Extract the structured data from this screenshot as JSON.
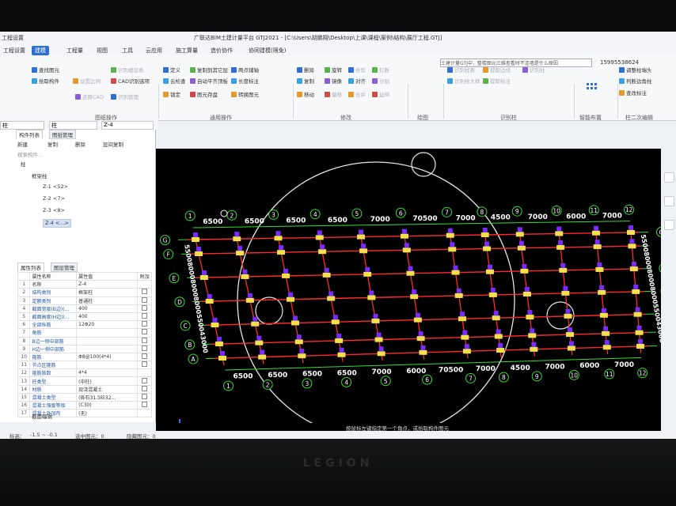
{
  "app": {
    "title": "广联达BIM土建计量平台 GTJ2021 - [C:\\Users\\胡鹏翔\\Desktop\\上课\\课程\\案例\\结构\\展厅工程.GTJ]",
    "quick_access": "工程设置"
  },
  "menu_tabs": [
    {
      "label": "工程设置",
      "active": false
    },
    {
      "label": "建模",
      "active": true
    },
    {
      "label": "工程量",
      "active": false
    },
    {
      "label": "视图",
      "active": false
    },
    {
      "label": "工具",
      "active": false
    },
    {
      "label": "云应用",
      "active": false
    },
    {
      "label": "施工算量",
      "active": false
    },
    {
      "label": "造价协作",
      "active": false
    },
    {
      "label": "协同建模(限免)",
      "active": false
    }
  ],
  "search": {
    "value": "土建计量GTJ中，整楼图元三维查看时不连墙是什么原因"
  },
  "phone": "15995538624",
  "ribbon": {
    "col1": [
      "查找图元",
      "拾取构件",
      "设置比例",
      "识别楼层表",
      "还原CAD",
      "CAD识别选项",
      "识别管理"
    ],
    "group_general": "通用操作",
    "general_items": [
      "定义",
      "云检查",
      "锁定",
      "复制到其它层",
      "自动平齐顶板",
      "图元存盘",
      "两点辅轴",
      "长度标注",
      "转换图元"
    ],
    "modify_items": [
      "删除",
      "复制",
      "移动",
      "旋转",
      "镜像",
      "偏移",
      "修剪",
      "对齐",
      "合并",
      "打断",
      "分割",
      "延伸"
    ],
    "group_modify": "修改",
    "group_draw": "绘图",
    "group_identify": "识别柱",
    "identify_items": [
      "识别柱表",
      "识别柱大样",
      "提取边线",
      "提取标注",
      "识别柱"
    ],
    "group_smart": "智能布置",
    "smart_items": [
      "调整柱端头",
      "判断边角柱",
      "查改标注"
    ],
    "group_column": "柱二次编辑",
    "group_cad": "图纸操作"
  },
  "selectors": {
    "category": "柱",
    "type": "柱",
    "name": "Z-4"
  },
  "left_strip": [
    "层",
    "",
    "",
    "项",
    "",
    "",
    ""
  ],
  "component_panel": {
    "tabs": [
      "构件列表",
      "图纸管理"
    ],
    "toolbar": [
      "新建",
      "复制",
      "删除",
      "层间复制"
    ],
    "search_placeholder": "搜索构件...",
    "tree": [
      {
        "label": "柱",
        "level": 0
      },
      {
        "label": "框架柱",
        "level": 1
      },
      {
        "label": "Z-1 <52>",
        "level": 2
      },
      {
        "label": "Z-2 <7>",
        "level": 2
      },
      {
        "label": "Z-3 <8>",
        "level": 2
      },
      {
        "label": "Z-4 <...>",
        "level": 2,
        "selected": true
      }
    ]
  },
  "property_panel": {
    "tabs": [
      "属性列表",
      "图层管理"
    ],
    "headers": [
      "属性名称",
      "属性值",
      "附加"
    ],
    "rows": [
      {
        "no": "1",
        "name": "名称",
        "value": "Z-4",
        "check": false
      },
      {
        "no": "2",
        "name": "结构类别",
        "value": "框架柱",
        "check": true
      },
      {
        "no": "3",
        "name": "定额类别",
        "value": "普通柱",
        "check": true
      },
      {
        "no": "4",
        "name": "截面宽度(B边)(...",
        "value": "400",
        "check": true
      },
      {
        "no": "5",
        "name": "截面高度(H边)(...",
        "value": "400",
        "check": true
      },
      {
        "no": "6",
        "name": "全部纵筋",
        "value": "12Φ20",
        "check": true
      },
      {
        "no": "7",
        "name": "角筋",
        "value": "",
        "check": true
      },
      {
        "no": "8",
        "name": "B边一侧中部筋",
        "value": "",
        "check": true
      },
      {
        "no": "9",
        "name": "H边一侧中部筋",
        "value": "",
        "check": true
      },
      {
        "no": "10",
        "name": "箍筋",
        "value": "Φ8@100(4*4)",
        "check": true
      },
      {
        "no": "11",
        "name": "节点区箍筋",
        "value": "",
        "check": true
      },
      {
        "no": "12",
        "name": "箍筋肢数",
        "value": "4*4",
        "check": false
      },
      {
        "no": "13",
        "name": "柱类型",
        "value": "(中柱)",
        "check": true
      },
      {
        "no": "14",
        "name": "材质",
        "value": "现浇混凝土",
        "check": true
      },
      {
        "no": "15",
        "name": "混凝土类型",
        "value": "(砾石31.5砼32...",
        "check": true
      },
      {
        "no": "16",
        "name": "混凝土强度等级",
        "value": "(C30)",
        "check": true
      },
      {
        "no": "17",
        "name": "混凝土外加剂",
        "value": "(无)",
        "check": false
      }
    ],
    "footer_tab": "截面编辑"
  },
  "drawing": {
    "top_axes": [
      "1",
      "2",
      "3",
      "4",
      "5",
      "6",
      "7",
      "8",
      "9",
      "10",
      "11",
      "12"
    ],
    "bottom_axes": [
      "1",
      "2",
      "3",
      "4",
      "5",
      "6",
      "7",
      "8",
      "9",
      "10",
      "11",
      "12"
    ],
    "left_axes": [
      "G",
      "F",
      "E",
      "D",
      "C",
      "B",
      "A"
    ],
    "right_axes": [
      "G",
      "E",
      "D",
      "C",
      "A"
    ],
    "top_dims": [
      "6500",
      "6500",
      "6500",
      "6500",
      "7000",
      "70500",
      "7000",
      "4500",
      "7000",
      "6000",
      "7000"
    ],
    "bottom_dims": [
      "6500",
      "6500",
      "6500",
      "6500",
      "7000",
      "6000",
      "70500",
      "7000",
      "4500",
      "7000",
      "6000",
      "7000"
    ],
    "left_dims": "5500800080008000550043000",
    "right_dims": "5500800080008000550043000",
    "colors": {
      "grid": "#ff2a2a",
      "axis": "#33dd33",
      "column": "#f2e14a",
      "column_mark": "#7a2cff",
      "dim": "#ffffff"
    }
  },
  "hint": "按鼠标左键指定第一个角点，或拾取构件图元",
  "status": {
    "elevation": "标高：",
    "elev_value": "-1.5 ~ -0.1",
    "selected": "选中图元：0",
    "hidden": "隐藏图元：0"
  }
}
